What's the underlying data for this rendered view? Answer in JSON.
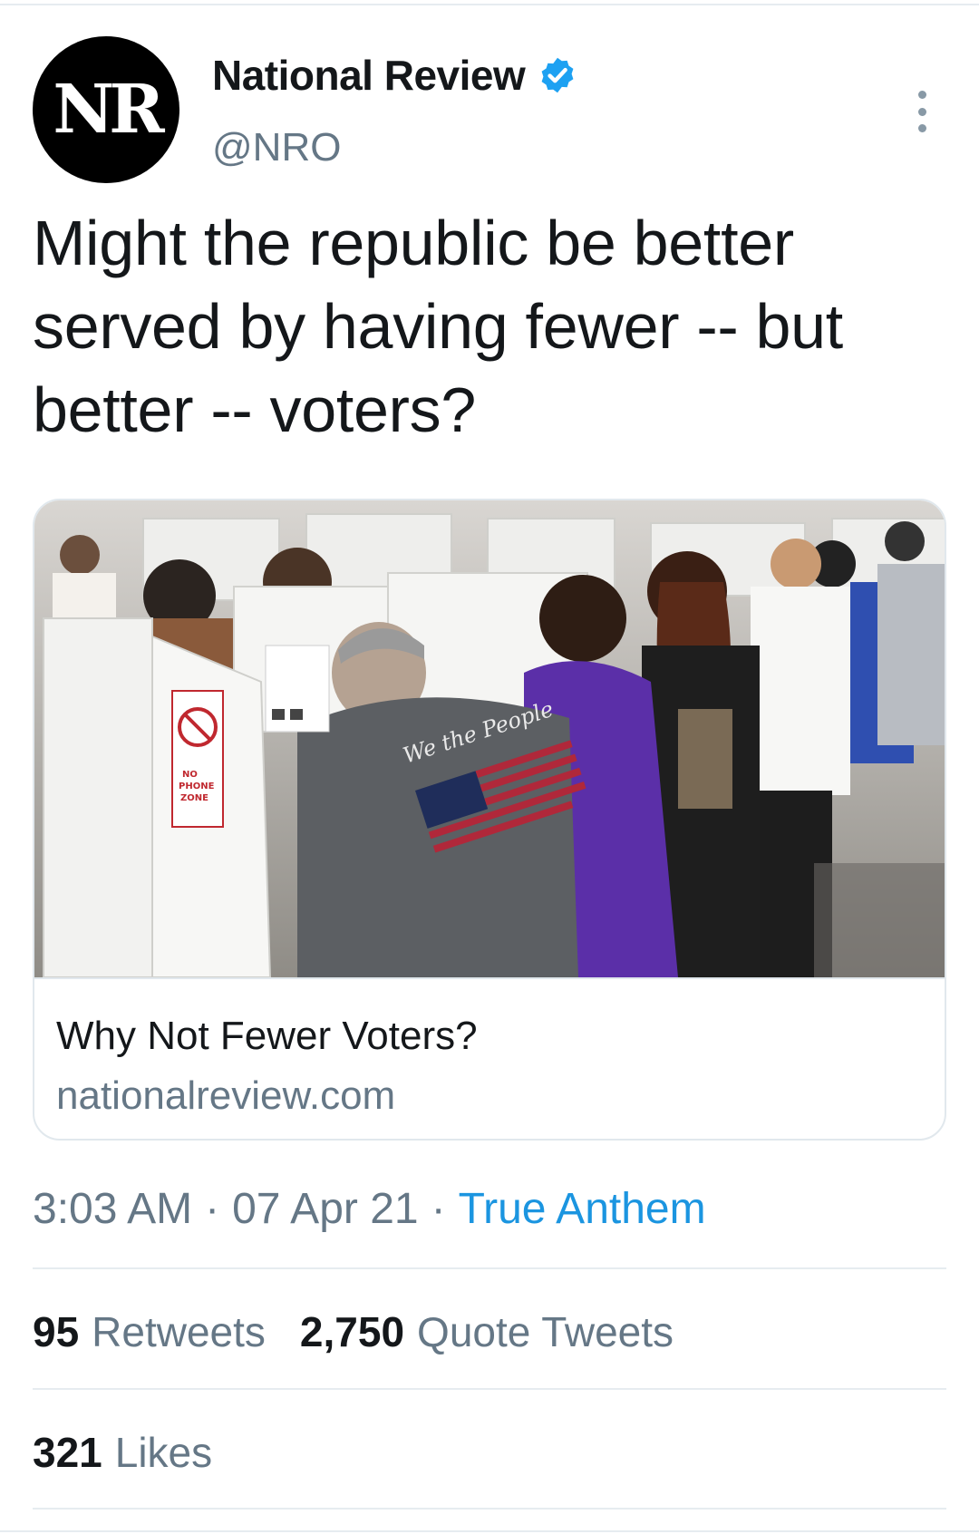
{
  "author": {
    "avatar_text": "NR",
    "display_name": "National Review",
    "handle": "@NRO",
    "verified_icon": "verified-badge-icon",
    "verified_color": "#1da1f2"
  },
  "tweet": {
    "text": "Might the republic be better served by having fewer -- but better -- voters?"
  },
  "card": {
    "title": "Why Not Fewer Voters?",
    "domain": "nationalreview.com",
    "image_sign_text": "NO PHONE ZONE",
    "image_shirt_text": "We the People"
  },
  "meta": {
    "time": "3:03 AM",
    "separator": "·",
    "date": "07 Apr 21",
    "source": "True Anthem"
  },
  "stats": {
    "retweets_count": "95",
    "retweets_label": "Retweets",
    "quotes_count": "2,750",
    "quotes_label": "Quote Tweets",
    "likes_count": "321",
    "likes_label": "Likes"
  },
  "colors": {
    "text_primary": "#14171a",
    "text_secondary": "#657786",
    "link": "#1b95e0",
    "border": "#e1e8ed"
  },
  "icons": {
    "more": "more-vertical-icon"
  }
}
